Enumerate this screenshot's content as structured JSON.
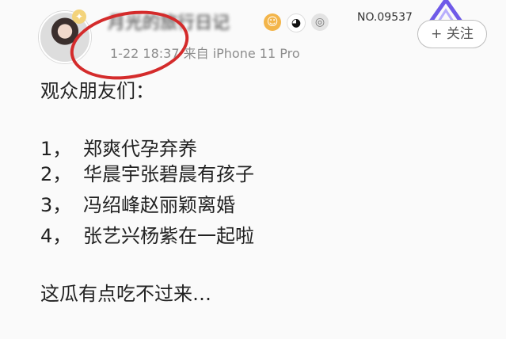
{
  "profile": {
    "username": "月光的旅行日记",
    "nfc": "NO.09537",
    "time": "1-22 18:37",
    "source": "来自 iPhone 11 Pro"
  },
  "actions": {
    "follow": "+ 关注"
  },
  "post": {
    "greeting": "观众朋友们：",
    "items": [
      {
        "num": "1，",
        "text": "郑爽代孕弃养"
      },
      {
        "num": "2，",
        "text": "华晨宇张碧晨有孩子"
      },
      {
        "num": "3，",
        "text": "冯绍峰赵丽颖离婚"
      },
      {
        "num": "4，",
        "text": "张艺兴杨紫在一起啦"
      }
    ],
    "ending": "这瓜有点吃不过来…"
  },
  "icons": {
    "vip": "vip-icon",
    "panda": "panda-icon",
    "medal": "medal-icon",
    "fans": "fans-icon"
  },
  "colors": {
    "highlight": "#d42b2b",
    "meta": "#8d8d8d"
  }
}
